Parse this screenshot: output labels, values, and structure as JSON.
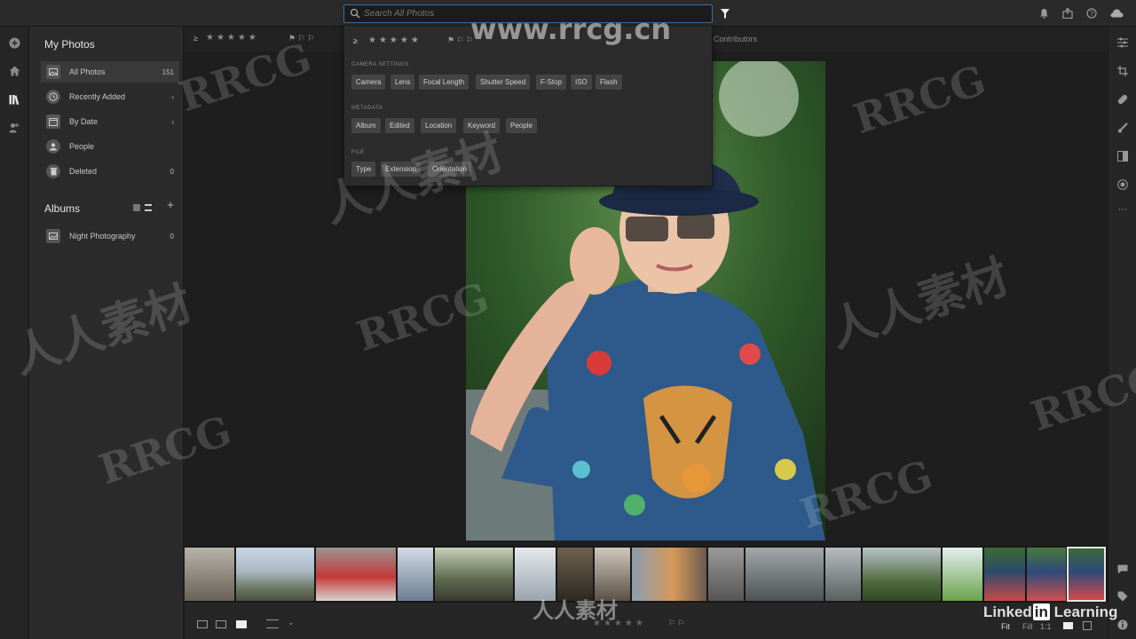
{
  "search": {
    "placeholder": "Search All Photos"
  },
  "sidebar": {
    "my_photos_title": "My Photos",
    "items": [
      {
        "label": "All Photos",
        "count": "151"
      },
      {
        "label": "Recently Added",
        "count": "‹"
      },
      {
        "label": "By Date",
        "count": "‹"
      },
      {
        "label": "People",
        "count": ""
      },
      {
        "label": "Deleted",
        "count": "0"
      }
    ],
    "albums_title": "Albums",
    "albums": [
      {
        "label": "Night Photography",
        "count": "0"
      }
    ]
  },
  "toolbar": {
    "rating_prefix": "≥",
    "stars": "★★★★★",
    "contributors": "Contributors"
  },
  "dropdown": {
    "rating_prefix": "≥",
    "stars": "★★★★★",
    "camera_title": "CAMERA SETTINGS",
    "camera_chips": [
      "Camera",
      "Lens",
      "Focal Length",
      "Shutter Speed",
      "F-Stop",
      "ISO",
      "Flash"
    ],
    "metadata_title": "METADATA",
    "metadata_chips": [
      "Album",
      "Edited",
      "Location",
      "Keyword",
      "People"
    ],
    "file_title": "FILE",
    "file_chips": [
      "Type",
      "Extension",
      "Orientation"
    ]
  },
  "bottom": {
    "stars": "★★★★★",
    "fit": "Fit",
    "fill": "Fill",
    "ratio": "1:1"
  },
  "watermarks": {
    "url": "www.rrcg.cn",
    "brand": "RRCG",
    "cn": "人人素材",
    "linkedin": "Linked",
    "linkedin_in": "in",
    "learning": "Learning"
  },
  "colors": {
    "accent": "#3b6fa8",
    "panel": "#2b2b2b",
    "selected": "#3a3a3a"
  }
}
